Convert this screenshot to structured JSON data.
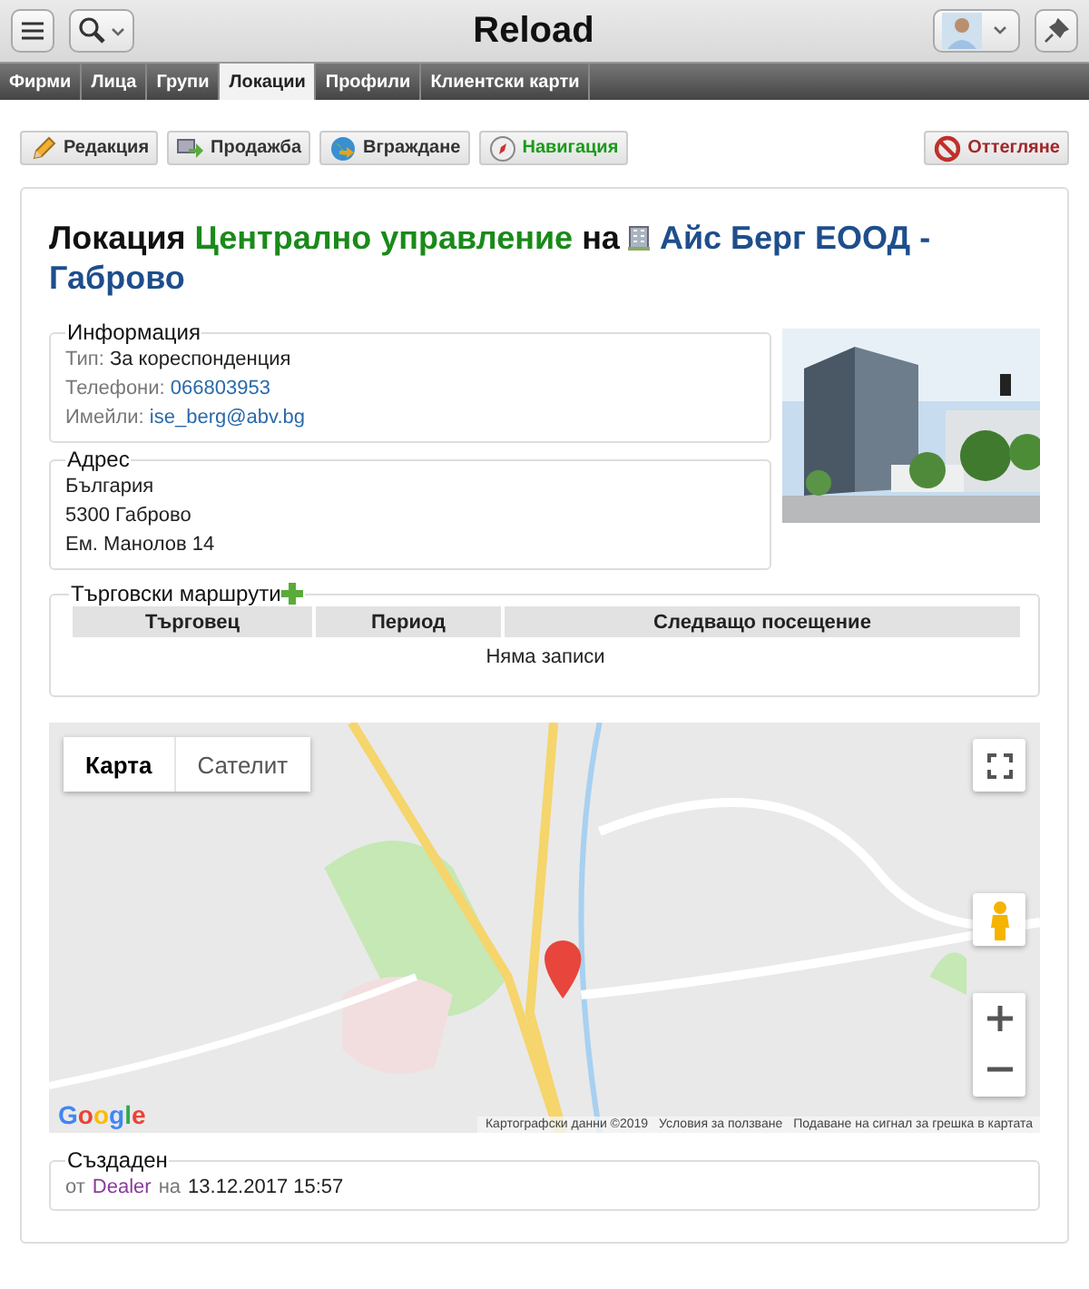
{
  "app": {
    "title": "Reload"
  },
  "tabs": [
    {
      "label": "Фирми",
      "selected": false
    },
    {
      "label": "Лица",
      "selected": false
    },
    {
      "label": "Групи",
      "selected": false
    },
    {
      "label": "Локации",
      "selected": true
    },
    {
      "label": "Профили",
      "selected": false
    },
    {
      "label": "Клиентски карти",
      "selected": false
    }
  ],
  "actions": [
    {
      "label": "Редакция",
      "kind": "edit"
    },
    {
      "label": "Продажба",
      "kind": "sale"
    },
    {
      "label": "Вграждане",
      "kind": "embed"
    },
    {
      "label": "Навигация",
      "kind": "navigate"
    },
    {
      "label": "Оттегляне",
      "kind": "withdraw"
    }
  ],
  "heading": [
    {
      "text": "Локация",
      "kind": "plain"
    },
    {
      "text": "Централно управление",
      "kind": "location"
    },
    {
      "text": "на",
      "kind": "plain"
    },
    {
      "text": "Айс Берг ЕООД - Габрово",
      "kind": "company"
    }
  ],
  "info": {
    "legend": "Информация",
    "rows": [
      {
        "label": "Тип:",
        "value": "За кореспонденция",
        "kind": "text"
      },
      {
        "label": "Телефони:",
        "value": "066803953",
        "kind": "link"
      },
      {
        "label": "Имейли:",
        "value": "ise_berg@abv.bg",
        "kind": "link"
      }
    ]
  },
  "address": {
    "legend": "Адрес",
    "lines": [
      "България",
      "5300 Габрово",
      "Ем. Манолов 14"
    ]
  },
  "routes": {
    "legend": "Търговски маршрути",
    "columns": [
      "Търговец",
      "Период",
      "Следващо посещение"
    ],
    "empty": "Няма записи"
  },
  "map": {
    "types": [
      {
        "label": "Карта",
        "selected": true
      },
      {
        "label": "Сателит",
        "selected": false
      }
    ],
    "logo": "Google",
    "attribution": [
      "Картографски данни ©2019",
      "Условия за ползване",
      "Подаване на сигнал за грешка в картата"
    ]
  },
  "created": {
    "legend": "Създаден",
    "by_prefix": "от",
    "user": "Dealer",
    "on_prefix": "на",
    "date": "13.12.2017 15:57"
  }
}
